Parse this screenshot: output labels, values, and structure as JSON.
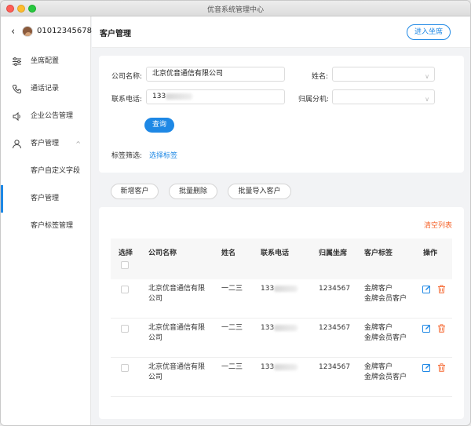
{
  "window": {
    "title": "优音系统管理中心"
  },
  "sidebar": {
    "phone": "01012345678",
    "items": [
      {
        "label": "坐席配置",
        "icon": "sliders-icon"
      },
      {
        "label": "通话记录",
        "icon": "phone-icon"
      },
      {
        "label": "企业公告管理",
        "icon": "speaker-icon"
      },
      {
        "label": "客户管理",
        "icon": "user-icon",
        "caret": "^"
      },
      {
        "label": "客户自定义字段"
      },
      {
        "label": "客户管理",
        "active": true
      },
      {
        "label": "客户标签管理"
      }
    ]
  },
  "header": {
    "title": "客户管理",
    "enter_label": "进入坐席"
  },
  "filter": {
    "company_label": "公司名称:",
    "company_value": "北京优音通信有限公司",
    "name_label": "姓名:",
    "phone_label": "联系电话:",
    "phone_value": "133",
    "ext_label": "归属分机:",
    "query_label": "查询",
    "tag_label": "标签筛选:",
    "tag_link": "选择标签"
  },
  "actions": {
    "add": "新增客户",
    "batch_delete": "批量删除",
    "batch_import": "批量导入客户"
  },
  "table": {
    "clear_label": "清空列表",
    "headers": [
      "选择",
      "公司名称",
      "姓名",
      "联系电话",
      "归属坐席",
      "客户标签",
      "操作"
    ],
    "rows": [
      {
        "company_1": "北京优音通信有限",
        "company_2": "公司",
        "name": "一二三",
        "phone": "133",
        "seat": "1234567",
        "tag_1": "金牌客户",
        "tag_2": "金牌会员客户"
      },
      {
        "company_1": "北京优音通信有限",
        "company_2": "公司",
        "name": "一二三",
        "phone": "133",
        "seat": "1234567",
        "tag_1": "金牌客户",
        "tag_2": "金牌会员客户"
      },
      {
        "company_1": "北京优音通信有限",
        "company_2": "公司",
        "name": "一二三",
        "phone": "133",
        "seat": "1234567",
        "tag_1": "金牌客户",
        "tag_2": "金牌会员客户"
      }
    ]
  },
  "colors": {
    "accent": "#1e88e5",
    "danger": "#f5642c"
  }
}
